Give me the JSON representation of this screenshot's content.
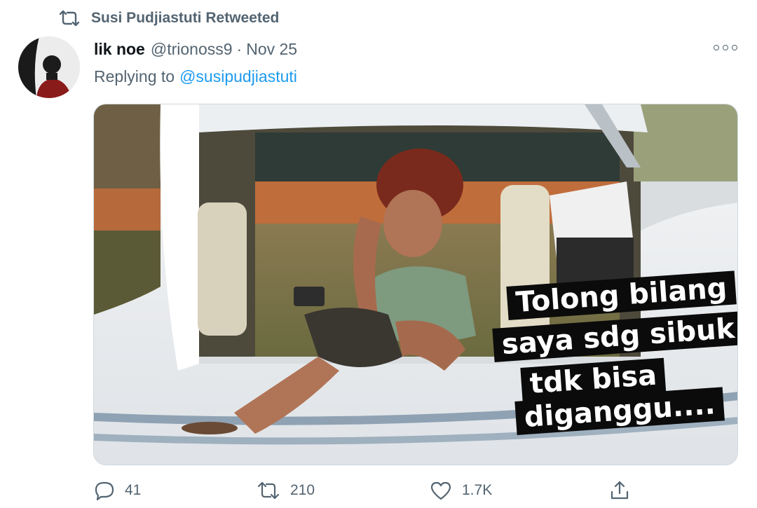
{
  "retweet": {
    "label": "Susi Pudjiastuti Retweeted",
    "icon": "retweet-icon"
  },
  "author": {
    "display_name": "lik noe",
    "handle": "@trionoss9",
    "separator": "·",
    "date": "Nov 25"
  },
  "reply": {
    "prefix": "Replying to",
    "mention": "@susipudjiastuti"
  },
  "media": {
    "caption_lines": [
      "Tolong bilang",
      "saya sdg sibuk",
      "tdk bisa",
      "diganggu...."
    ]
  },
  "actions": {
    "reply_count": "41",
    "retweet_count": "210",
    "like_count": "1.7K"
  },
  "colors": {
    "secondary_text": "#536471",
    "link": "#1d9bf0",
    "caption_bg": "#0b0b0b"
  }
}
